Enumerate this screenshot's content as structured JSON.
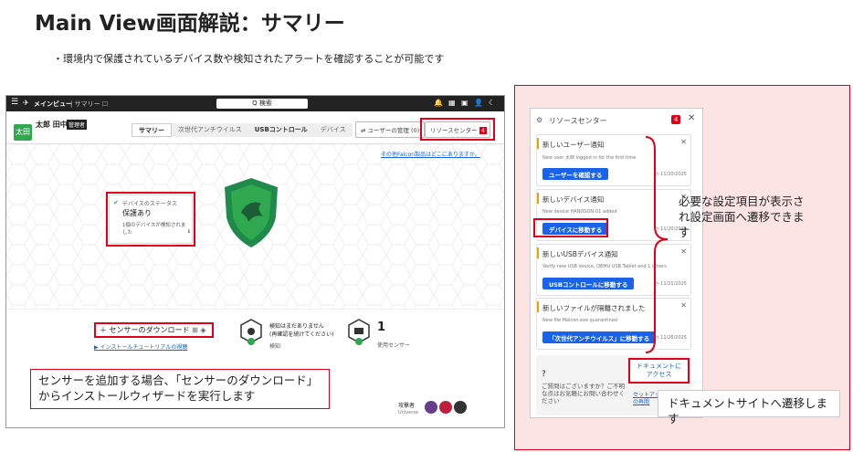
{
  "slide": {
    "title": "Main View画面解説：サマリー",
    "subtitle": "・環境内で保護されているデバイス数や検知されたアラートを確認することが可能です"
  },
  "app": {
    "menu_label": "メインビュー",
    "breadcrumb": "サマリー",
    "search_placeholder": "Q 検索",
    "user_name": "太郎 田中",
    "user_role": "管理者",
    "avatar_text": "太田",
    "tabs": [
      {
        "label": "サマリー",
        "active": true
      },
      {
        "label": "次世代アンチウイルス",
        "active": false
      },
      {
        "label": "USBコントロール",
        "active": false
      },
      {
        "label": "デバイス",
        "active": false
      }
    ],
    "user_mgmt_label": "ユーザーの管理 (0)",
    "resource_center_label": "リソースセンター",
    "resource_center_badge": "4",
    "info_link": "その他Falcon製品はどこにありますか。",
    "device_status_label": "デバイスのステータス",
    "device_status_value": "保護あり",
    "device_detection_note": "1個のデバイスが検知されました",
    "sensor_download_label": "＋ センサーのダウンロード",
    "install_tutorial_link": "インストールチュートリアルの視聴",
    "detection_title": "検知はまだありません",
    "detection_sub": "(再確認を続けてください)",
    "detection_label": "検知",
    "sensors_value": "1",
    "sensors_label": "使用センサー",
    "attacker_label": "攻撃者",
    "attacker_sub": "Universe"
  },
  "callouts": {
    "sensor": "センサーを追加する場合、「センサーのダウンロード」からインストールウィザードを実行します",
    "settings": "必要な設定項目が表示され設定画面へ遷移できます",
    "docs": "ドキュメントサイトへ遷移します"
  },
  "resource_panel": {
    "title": "リソースセンター",
    "badge": "4",
    "notifications": [
      {
        "title": "新しいユーザー通知",
        "sub": "New user 太郎 logged in for the first time",
        "button": "ユーザーを確認する",
        "date": "11/20/2025"
      },
      {
        "title": "新しいデバイス通知",
        "sub": "New device HANDSON-01 added",
        "button": "デバイスに移動する",
        "date": "11/20/2025"
      },
      {
        "title": "新しいUSBデバイス通知",
        "sub": "Verify new USB device, QEMU USB Tablet and 1 others",
        "button": "USBコントロールに移動する",
        "date": "11/21/2025"
      },
      {
        "title": "新しいファイルが隔離されました",
        "sub": "New file Malcon.exe quarantined",
        "button": "「次世代アンチウイルス」に移動する",
        "date": "11/26/2025"
      }
    ],
    "question": "ご質問はございますか？ご不明な点はお気軽にお問い合わせください",
    "docs_button": "ドキュメントにアクセス",
    "setup_link": "セットアップガイドの再開"
  },
  "colors": {
    "accent": "#1a63e8",
    "highlight": "#e0001a",
    "pink": "#fde4e4",
    "shield": "#2fa84f"
  }
}
